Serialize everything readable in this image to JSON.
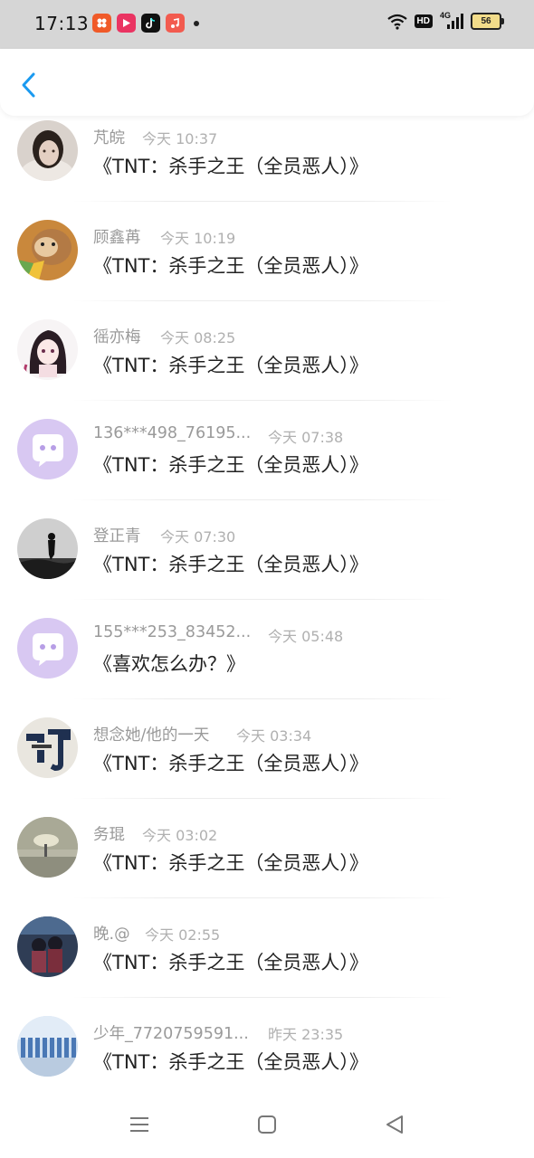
{
  "status_bar": {
    "time": "17:13",
    "network": "4G",
    "hd": "HD",
    "battery": "56",
    "app_icons": [
      "app-icon-1",
      "video-app-icon",
      "tiktok-icon",
      "music-app-icon"
    ]
  },
  "header": {
    "back_icon": "chevron-left-icon",
    "accent_color": "#1a9af0"
  },
  "messages": [
    {
      "name": "芃皖",
      "time": "今天 10:37",
      "text": "《TNT：杀手之王（全员恶人）》"
    },
    {
      "name": "顾鑫苒",
      "time": "今天 10:19",
      "text": "《TNT：杀手之王（全员恶人）》"
    },
    {
      "name": "徭亦梅",
      "time": "今天 08:25",
      "text": "《TNT：杀手之王（全员恶人）》"
    },
    {
      "name": "136***498_76195...",
      "time": "今天 07:38",
      "text": "《TNT：杀手之王（全员恶人）》"
    },
    {
      "name": "登正青",
      "time": "今天 07:30",
      "text": "《TNT：杀手之王（全员恶人）》"
    },
    {
      "name": "155***253_83452...",
      "time": "今天 05:48",
      "text": "《喜欢怎么办？》"
    },
    {
      "name": "想念她/他的一天",
      "time": "今天 03:34",
      "text": "《TNT：杀手之王（全员恶人）》"
    },
    {
      "name": "务琨",
      "time": "今天 03:02",
      "text": "《TNT：杀手之王（全员恶人）》"
    },
    {
      "name": "晚.@",
      "time": "今天 02:55",
      "text": "《TNT：杀手之王（全员恶人）》"
    },
    {
      "name": "少年_7720759591...",
      "time": "昨天 23:35",
      "text": "《TNT：杀手之王（全员恶人）》"
    }
  ],
  "nav_bar": {
    "menu_icon": "menu-icon",
    "home_icon": "home-square-icon",
    "back_icon": "back-triangle-icon"
  }
}
